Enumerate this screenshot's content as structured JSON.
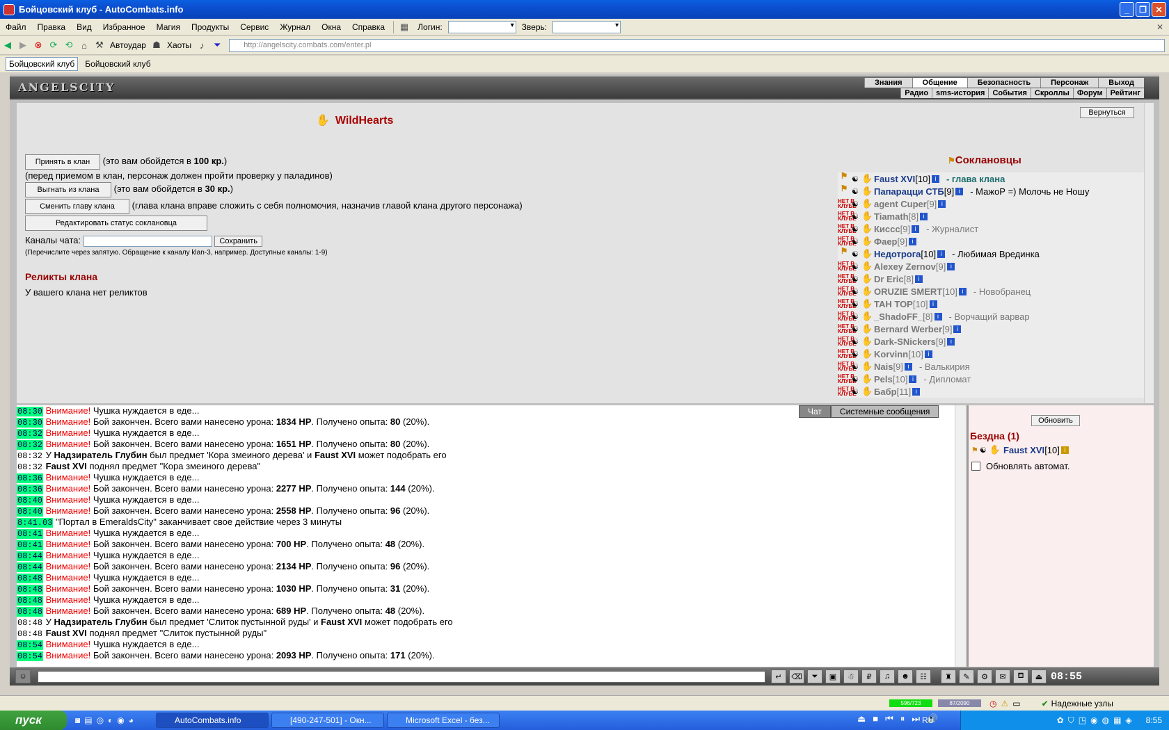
{
  "window": {
    "title": "Бойцовский клуб - AutoCombats.info"
  },
  "menu": [
    "Файл",
    "Правка",
    "Вид",
    "Избранное",
    "Магия",
    "Продукты",
    "Сервис",
    "Журнал",
    "Окна",
    "Справка"
  ],
  "login_label": "Логин:",
  "pet_label": "Зверь:",
  "toolbar": {
    "autohit": "Автоудар",
    "chaots": "Хаоты"
  },
  "address": "http://angelscity.combats.com/enter.pl",
  "tabs": [
    "Бойцовский клуб",
    "Бойцовский клуб"
  ],
  "site": {
    "logo": "ANGELSCITY",
    "nav_top": [
      "Знания",
      "Общение",
      "Безопасность",
      "Персонаж",
      "Выход"
    ],
    "nav_bottom": [
      "Радио",
      "sms-история",
      "События",
      "Скроллы",
      "Форум",
      "Рейтинг"
    ]
  },
  "clan": {
    "name": "WildHearts",
    "back_button": "Вернуться",
    "accept_button": "Принять в клан",
    "accept_note1": "(это вам обойдется в ",
    "accept_price": "100 кр.",
    "accept_note2": ")",
    "accept_note3": "(перед приемом в клан, персонаж должен пройти проверку у паладинов)",
    "kick_button": "Выгнать из клана",
    "kick_note1": "(это вам обойдется в ",
    "kick_price": "30 кр.",
    "kick_note2": ")",
    "change_head_button": "Сменить главу клана",
    "change_head_note": "(глава клана вправе сложить с себя полномочия, назначив главой клана другого персонажа)",
    "edit_status_button": "Редактировать статус соклановца",
    "chat_label": "Каналы чата:",
    "save_button": "Сохранить",
    "chat_hint": "(Перечислите через запятую. Обращение к каналу klan-3, например. Доступные каналы: 1-9)",
    "relics_title": "Реликты клана",
    "relics_text": "У вашего клана нет реликтов",
    "members_title": "Соклановцы",
    "members": [
      {
        "name": "Faust XVI",
        "level": "[10]",
        "online": true,
        "status": "- глава клана",
        "lead": true
      },
      {
        "name": "Папарацци СТБ",
        "level": "[9]",
        "online": true,
        "status": "- МажоР =) Молочь не Ношу",
        "lead": false
      },
      {
        "name": "agent Cuper",
        "level": "[9]",
        "online": false,
        "status": "",
        "lead": false
      },
      {
        "name": "Tiamath",
        "level": "[8]",
        "online": false,
        "status": "",
        "lead": false
      },
      {
        "name": "Кисcс",
        "level": "[9]",
        "online": false,
        "status": "- Журналист",
        "lead": false
      },
      {
        "name": "Фаер",
        "level": "[9]",
        "online": false,
        "status": "",
        "lead": false
      },
      {
        "name": "Недотрога",
        "level": "[10]",
        "online": true,
        "status": "- Любимая Врединка",
        "lead": false
      },
      {
        "name": "Alexey Zernov",
        "level": "[9]",
        "online": false,
        "status": "",
        "lead": false
      },
      {
        "name": "Dr Eric",
        "level": "[8]",
        "online": false,
        "status": "",
        "lead": false
      },
      {
        "name": "ORUZIE SMERT",
        "level": "[10]",
        "online": false,
        "status": "- Новобранец",
        "lead": false
      },
      {
        "name": "TAH TOP",
        "level": "[10]",
        "online": false,
        "status": "",
        "lead": false
      },
      {
        "name": "_ShadoFF_",
        "level": "[8]",
        "online": false,
        "status": "- Ворчащий варвар",
        "lead": false
      },
      {
        "name": "Bernard Werber",
        "level": "[9]",
        "online": false,
        "status": "",
        "lead": false
      },
      {
        "name": "Dark-SNickers",
        "level": "[9]",
        "online": false,
        "status": "",
        "lead": false
      },
      {
        "name": "Korvinn",
        "level": "[10]",
        "online": false,
        "status": "",
        "lead": false
      },
      {
        "name": "Nais",
        "level": "[9]",
        "online": false,
        "status": "- Валькирия",
        "lead": false
      },
      {
        "name": "Pels",
        "level": "[10]",
        "online": false,
        "status": "- Дипломат",
        "lead": false
      },
      {
        "name": "Бабр",
        "level": "[11]",
        "online": false,
        "status": "",
        "lead": false
      }
    ]
  },
  "log_tabs": [
    "Чат",
    "Системные сообщения"
  ],
  "log": [
    {
      "t": "08:30",
      "hl": true,
      "warn": true,
      "parts": [
        {
          "x": "Чушка нуждается в еде..."
        }
      ]
    },
    {
      "t": "08:30",
      "hl": true,
      "warn": true,
      "parts": [
        {
          "x": "Бой закончен. Всего вами нанесено урона: "
        },
        {
          "b": "1834 HP"
        },
        {
          "x": ". Получено опыта: "
        },
        {
          "b": "80"
        },
        {
          "x": " (20%)."
        }
      ]
    },
    {
      "t": "08:32",
      "hl": true,
      "warn": true,
      "parts": [
        {
          "x": "Чушка нуждается в еде..."
        }
      ]
    },
    {
      "t": "08:32",
      "hl": true,
      "warn": true,
      "parts": [
        {
          "x": "Бой закончен. Всего вами нанесено урона: "
        },
        {
          "b": "1651 HP"
        },
        {
          "x": ". Получено опыта: "
        },
        {
          "b": "80"
        },
        {
          "x": " (20%)."
        }
      ]
    },
    {
      "t": "08:32",
      "hl": false,
      "warn": false,
      "parts": [
        {
          "x": "У "
        },
        {
          "b": "Надзиратель Глубин"
        },
        {
          "x": " был предмет 'Кора змеиного дерева' и "
        },
        {
          "b": "Faust XVI"
        },
        {
          "x": " может подобрать его"
        }
      ]
    },
    {
      "t": "08:32",
      "hl": false,
      "warn": false,
      "parts": [
        {
          "b": "Faust XVI"
        },
        {
          "x": " поднял предмет \"Кора змеиного дерева\""
        }
      ]
    },
    {
      "t": "08:36",
      "hl": true,
      "warn": true,
      "parts": [
        {
          "x": "Чушка нуждается в еде..."
        }
      ]
    },
    {
      "t": "08:36",
      "hl": true,
      "warn": true,
      "parts": [
        {
          "x": "Бой закончен. Всего вами нанесено урона: "
        },
        {
          "b": "2277 HP"
        },
        {
          "x": ". Получено опыта: "
        },
        {
          "b": "144"
        },
        {
          "x": " (20%)."
        }
      ]
    },
    {
      "t": "08:40",
      "hl": true,
      "warn": true,
      "parts": [
        {
          "x": "Чушка нуждается в еде..."
        }
      ]
    },
    {
      "t": "08:40",
      "hl": true,
      "warn": true,
      "parts": [
        {
          "x": "Бой закончен. Всего вами нанесено урона: "
        },
        {
          "b": "2558 HP"
        },
        {
          "x": ". Получено опыта: "
        },
        {
          "b": "96"
        },
        {
          "x": " (20%)."
        }
      ]
    },
    {
      "t": "8:41.03",
      "hl": true,
      "warn": false,
      "parts": [
        {
          "x": "\"Портал в EmeraldsCity\" заканчивает свое действие через 3 минуты"
        }
      ]
    },
    {
      "t": "08:41",
      "hl": true,
      "warn": true,
      "parts": [
        {
          "x": "Чушка нуждается в еде..."
        }
      ]
    },
    {
      "t": "08:41",
      "hl": true,
      "warn": true,
      "parts": [
        {
          "x": "Бой закончен. Всего вами нанесено урона: "
        },
        {
          "b": "700 HP"
        },
        {
          "x": ". Получено опыта: "
        },
        {
          "b": "48"
        },
        {
          "x": " (20%)."
        }
      ]
    },
    {
      "t": "08:44",
      "hl": true,
      "warn": true,
      "parts": [
        {
          "x": "Чушка нуждается в еде..."
        }
      ]
    },
    {
      "t": "08:44",
      "hl": true,
      "warn": true,
      "parts": [
        {
          "x": "Бой закончен. Всего вами нанесено урона: "
        },
        {
          "b": "2134 HP"
        },
        {
          "x": ". Получено опыта: "
        },
        {
          "b": "96"
        },
        {
          "x": " (20%)."
        }
      ]
    },
    {
      "t": "08:48",
      "hl": true,
      "warn": true,
      "parts": [
        {
          "x": "Чушка нуждается в еде..."
        }
      ]
    },
    {
      "t": "08:48",
      "hl": true,
      "warn": true,
      "parts": [
        {
          "x": "Бой закончен. Всего вами нанесено урона: "
        },
        {
          "b": "1030 HP"
        },
        {
          "x": ". Получено опыта: "
        },
        {
          "b": "31"
        },
        {
          "x": " (20%)."
        }
      ]
    },
    {
      "t": "08:48",
      "hl": true,
      "warn": true,
      "parts": [
        {
          "x": "Чушка нуждается в еде..."
        }
      ]
    },
    {
      "t": "08:48",
      "hl": true,
      "warn": true,
      "parts": [
        {
          "x": "Бой закончен. Всего вами нанесено урона: "
        },
        {
          "b": "689 HP"
        },
        {
          "x": ". Получено опыта: "
        },
        {
          "b": "48"
        },
        {
          "x": " (20%)."
        }
      ]
    },
    {
      "t": "08:48",
      "hl": false,
      "warn": false,
      "parts": [
        {
          "x": "У "
        },
        {
          "b": "Надзиратель Глубин"
        },
        {
          "x": " был предмет 'Слиток пустынной руды' и "
        },
        {
          "b": "Faust XVI"
        },
        {
          "x": " может подобрать его"
        }
      ]
    },
    {
      "t": "08:48",
      "hl": false,
      "warn": false,
      "parts": [
        {
          "b": "Faust XVI"
        },
        {
          "x": " поднял предмет \"Слиток пустынной руды\""
        }
      ]
    },
    {
      "t": "08:54",
      "hl": true,
      "warn": true,
      "parts": [
        {
          "x": "Чушка нуждается в еде..."
        }
      ]
    },
    {
      "t": "08:54",
      "hl": true,
      "warn": true,
      "parts": [
        {
          "x": "Бой закончен. Всего вами нанесено урона: "
        },
        {
          "b": "2093 HP"
        },
        {
          "x": ". Получено опыта: "
        },
        {
          "b": "171"
        },
        {
          "x": " (20%)."
        }
      ]
    }
  ],
  "warn_label": "Внимание!",
  "right_panel": {
    "refresh_button": "Обновить",
    "abyss_title": "Бездна (1)",
    "abyss_member": "Faust XVI",
    "abyss_level": "[10]",
    "auto_refresh": "Обновлять автомат."
  },
  "clock": "08:55",
  "status": {
    "hp": "596/723",
    "mana": "87/2090",
    "secure": "Надежные узлы"
  },
  "taskbar": {
    "start": "пуск",
    "tasks": [
      "AutoCombats.info",
      "[490-247-501] - Окн...",
      "Microsoft Excel - без..."
    ],
    "lang": "RU",
    "time": "8:55"
  }
}
